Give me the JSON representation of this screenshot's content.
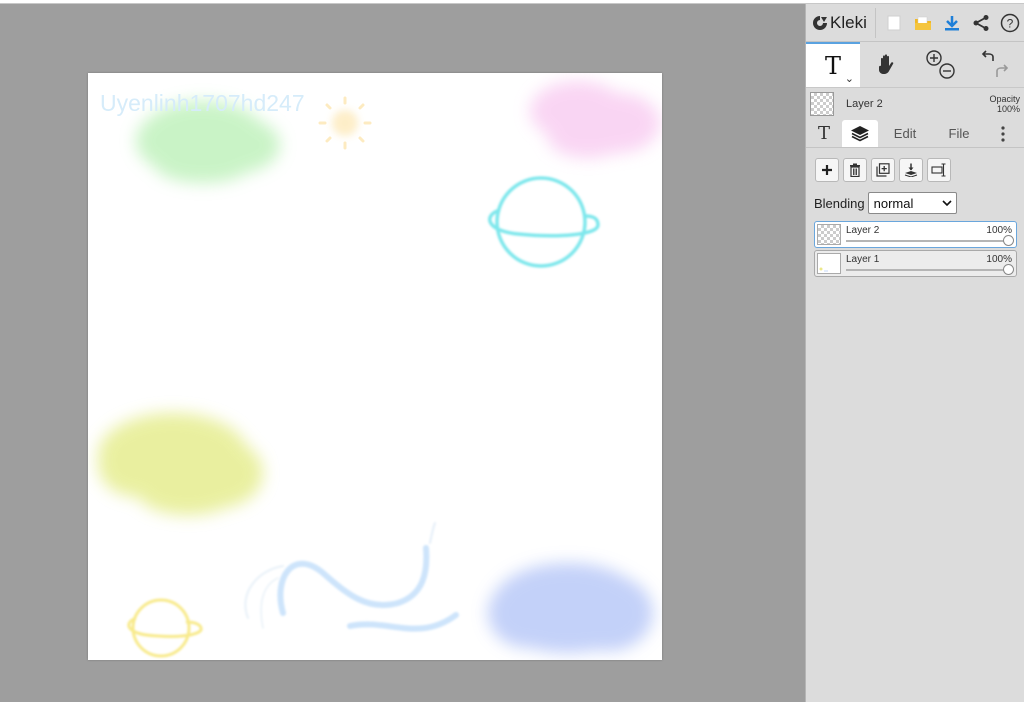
{
  "app": {
    "title": "Kleki"
  },
  "canvas": {
    "signature": "Uyenlinh1707hd247"
  },
  "header": {
    "icons": [
      "new-image-icon",
      "open-folder-icon",
      "download-icon",
      "share-icon",
      "help-icon"
    ]
  },
  "tools": {
    "active": "text-tool",
    "items": [
      "text-tool",
      "hand-tool",
      "zoom-tool",
      "undo-redo"
    ]
  },
  "layer_info": {
    "name": "Layer 2",
    "opacity_label": "Opacity",
    "opacity_value": "100%"
  },
  "tabs": {
    "edit": "Edit",
    "file": "File"
  },
  "blending": {
    "label": "Blending",
    "value": "normal"
  },
  "layers": [
    {
      "name": "Layer 2",
      "opacity": "100%",
      "selected": true
    },
    {
      "name": "Layer 1",
      "opacity": "100%",
      "selected": false
    }
  ],
  "colors": {
    "accent": "#5aa2e0",
    "workspace": "#9e9e9e",
    "panel": "#dcdcdc",
    "download": "#1e7fd8",
    "folder": "#f2b824"
  }
}
